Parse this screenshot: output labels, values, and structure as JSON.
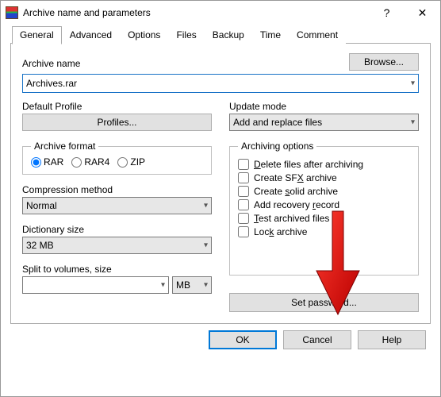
{
  "window": {
    "title": "Archive name and parameters",
    "help_glyph": "?",
    "close_glyph": "✕"
  },
  "tabs": {
    "items": [
      "General",
      "Advanced",
      "Options",
      "Files",
      "Backup",
      "Time",
      "Comment"
    ],
    "active_index": 0
  },
  "archive_name": {
    "label": "Archive name",
    "value": "Archives.rar",
    "browse_label": "Browse..."
  },
  "default_profile": {
    "label": "Default Profile",
    "button": "Profiles..."
  },
  "update_mode": {
    "label": "Update mode",
    "value": "Add and replace files"
  },
  "archive_format": {
    "legend": "Archive format",
    "options": [
      "RAR",
      "RAR4",
      "ZIP"
    ],
    "selected_index": 0
  },
  "compression": {
    "label": "Compression method",
    "value": "Normal"
  },
  "dictionary": {
    "label": "Dictionary size",
    "value": "32 MB"
  },
  "split": {
    "label": "Split to volumes, size",
    "value": "",
    "unit": "MB"
  },
  "archiving_options": {
    "legend": "Archiving options",
    "items": [
      {
        "label_pre": "",
        "accel": "D",
        "label_post": "elete files after archiving"
      },
      {
        "label_pre": "Create SF",
        "accel": "X",
        "label_post": " archive"
      },
      {
        "label_pre": "Create ",
        "accel": "s",
        "label_post": "olid archive"
      },
      {
        "label_pre": "Add recovery ",
        "accel": "r",
        "label_post": "ecord"
      },
      {
        "label_pre": "",
        "accel": "T",
        "label_post": "est archived files"
      },
      {
        "label_pre": "Loc",
        "accel": "k",
        "label_post": " archive"
      }
    ]
  },
  "set_password": {
    "label": "Set password..."
  },
  "buttons": {
    "ok": "OK",
    "cancel": "Cancel",
    "help": "Help"
  }
}
